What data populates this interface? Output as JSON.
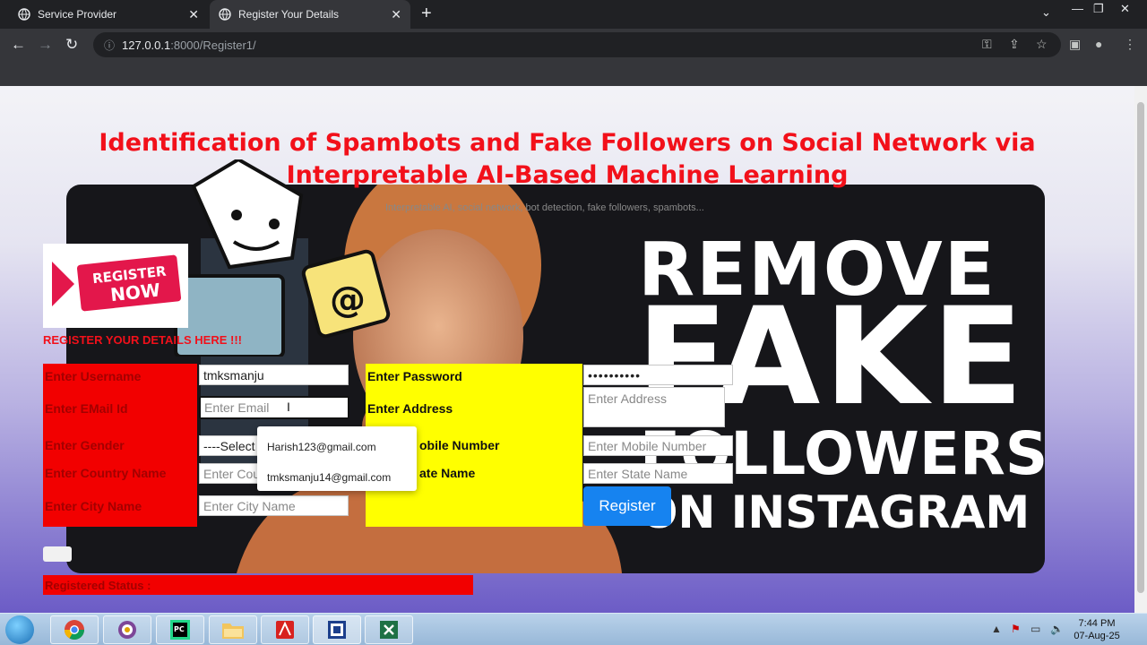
{
  "browser": {
    "tabs": [
      {
        "title": "Service Provider",
        "active": false
      },
      {
        "title": "Register Your Details",
        "active": true
      }
    ],
    "url_host": "127.0.0.1",
    "url_path": ":8000/Register1/"
  },
  "page": {
    "title": "Identification of Spambots and Fake Followers on Social Network via Interpretable AI-Based Machine Learning",
    "keywords": "Interpretable AI, social network, bot detection, fake followers, spambots...",
    "banner": {
      "line1": "REMOVE",
      "line2": "FAKE",
      "line3": "FOLLOWERS",
      "line4": "ON INSTAGRAM"
    },
    "register_image_text": {
      "top": "REGISTER",
      "bottom": "NOW"
    },
    "section_heading": "REGISTER YOUR DETAILS HERE !!!",
    "form": {
      "username_label": "Enter Username",
      "username_value": "tmksmanju",
      "email_label": "Enter EMail Id",
      "email_placeholder": "Enter Email",
      "gender_label": "Enter Gender",
      "gender_value": "----Select",
      "country_label": "Enter Country Name",
      "country_placeholder": "Enter Cou",
      "city_label": "Enter City Name",
      "city_placeholder": "Enter City Name",
      "password_label": "Enter Password",
      "password_value": "••••••••••",
      "address_label": "Enter Address",
      "address_placeholder": "Enter Address",
      "mobile_label": "obile Number",
      "mobile_placeholder": "Enter Mobile Number",
      "state_label": "ate Name",
      "state_placeholder": "Enter State Name",
      "register_button": "Register"
    },
    "email_suggestions": [
      "Harish123@gmail.com",
      "tmksmanju14@gmail.com"
    ],
    "status_label": "Registered Status :"
  },
  "taskbar": {
    "apps": [
      "chrome",
      "tor",
      "pycharm",
      "file-explorer",
      "acrobat",
      "app",
      "excel"
    ],
    "time": "7:44 PM",
    "date": "07-Aug-25"
  }
}
